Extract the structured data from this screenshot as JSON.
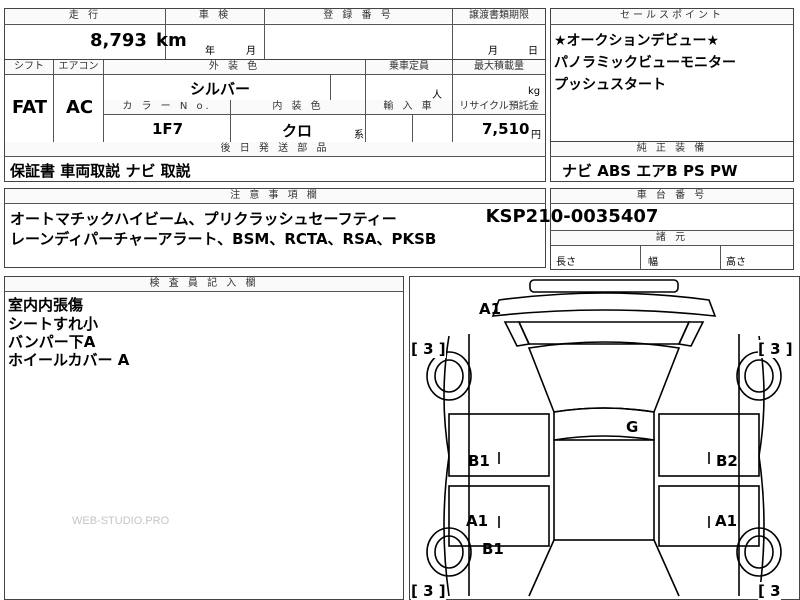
{
  "top_row": {
    "mileage_label": "走 行",
    "mileage_value": "8,793",
    "mileage_unit": "km",
    "inspection_label": "車 検",
    "inspection_year": "年",
    "inspection_month": "月",
    "registration_label": "登 録 番 号",
    "transfer_label": "譲渡書類期限",
    "transfer_month": "月",
    "transfer_day": "日"
  },
  "row2": {
    "shift_label": "シフト",
    "shift_value": "FAT",
    "aircon_label": "エアコン",
    "aircon_value": "AC",
    "exterior_label": "外 装 色",
    "exterior_value": "シルバー",
    "capacity_label": "乗車定員",
    "capacity_unit": "人",
    "load_label": "最大積載量",
    "load_unit": "kg",
    "color_no_label": "カ ラ ー N o.",
    "color_no_value": "1F7",
    "interior_label": "内 装 色",
    "interior_value": "クロ",
    "interior_suffix": "系",
    "import_label": "輸 入 車",
    "recycle_label": "リサイクル預託金",
    "recycle_value": "7,510",
    "recycle_unit": "円"
  },
  "sales_points": {
    "label": "セールスポイント",
    "lines": [
      "★オークションデビュー★",
      "パノラミックビューモニター",
      "プッシュスタート"
    ]
  },
  "later_parts": {
    "label": "後 日 発 送 部 品",
    "value": "保証書 車両取説 ナビ 取説"
  },
  "equipment": {
    "label": "純 正 装 備",
    "value": "ナビ ABS エアB PS PW"
  },
  "notes": {
    "label": "注 意 事 項 欄",
    "lines": [
      "オートマチックハイビーム、プリクラッシュセーフティー",
      "レーンディパーチャーアラート、BSM、RCTA、RSA、PKSB"
    ]
  },
  "chassis": {
    "label": "車 台 番 号",
    "value": "KSP210-0035407"
  },
  "dimensions": {
    "label": "諸 元",
    "length": "長さ",
    "width": "幅",
    "height": "高さ"
  },
  "inspector": {
    "label": "検 査 員 記 入 欄",
    "lines": [
      "室内内張傷",
      "シートすれ小",
      "バンパー下A",
      "ホイールカバー A"
    ]
  },
  "watermark": "WEB-STUDIO.PRO",
  "diagram": {
    "marks": {
      "front": "A1",
      "roof": "G",
      "left_front_door": "B1",
      "right_front_door": "B2",
      "left_rear_door": "A1",
      "right_rear_door": "A1",
      "left_rear": "B1"
    },
    "tire_left_front": "[ 3 ]",
    "tire_right_front": "[ 3 ]",
    "tire_left_rear": "[ 3 ]",
    "tire_right_rear": "[ 3"
  }
}
